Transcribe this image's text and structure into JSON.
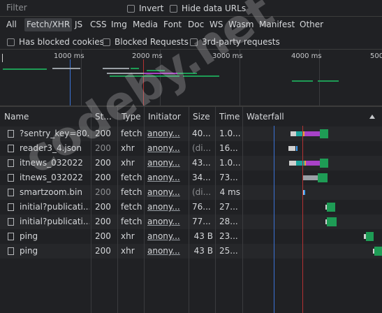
{
  "filter": {
    "placeholder": "Filter",
    "invert_label": "Invert",
    "hide_data_urls_label": "Hide data URLs"
  },
  "types": [
    "All",
    "Fetch/XHR",
    "JS",
    "CSS",
    "Img",
    "Media",
    "Font",
    "Doc",
    "WS",
    "Wasm",
    "Manifest",
    "Other"
  ],
  "active_type": "Fetch/XHR",
  "options": {
    "blocked_cookies": "Has blocked cookies",
    "blocked_requests": "Blocked Requests",
    "third_party": "3rd-party requests"
  },
  "overview": {
    "ticks": [
      "1000 ms",
      "2000 ms",
      "3000 ms",
      "4000 ms",
      "500"
    ]
  },
  "columns": {
    "name": "Name",
    "status": "St...",
    "type": "Type",
    "initiator": "Initiator",
    "size": "Size",
    "time": "Time",
    "waterfall": "Waterfall"
  },
  "rows": [
    {
      "name": "?sentry_key=80...",
      "status": "200",
      "type": "fetch",
      "initiator": "anony...",
      "size": "40...",
      "time": "1.0..."
    },
    {
      "name": "reader3_4.json",
      "status": "200",
      "type": "xhr",
      "initiator": "anony...",
      "size": "(di...",
      "time": "16..."
    },
    {
      "name": "itnews_032022",
      "status": "200",
      "type": "xhr",
      "initiator": "anony...",
      "size": "43...",
      "time": "1.0..."
    },
    {
      "name": "itnews_032022",
      "status": "200",
      "type": "fetch",
      "initiator": "anony...",
      "size": "34...",
      "time": "73..."
    },
    {
      "name": "smartzoom.bin",
      "status": "200",
      "type": "fetch",
      "initiator": "anony...",
      "size": "(di...",
      "time": "4 ms"
    },
    {
      "name": "initial?publicati...",
      "status": "200",
      "type": "fetch",
      "initiator": "anony...",
      "size": "76...",
      "time": "27..."
    },
    {
      "name": "initial?publicati...",
      "status": "200",
      "type": "fetch",
      "initiator": "anony...",
      "size": "77...",
      "time": "28..."
    },
    {
      "name": "ping",
      "status": "200",
      "type": "xhr",
      "initiator": "anony...",
      "size": "43 B",
      "time": "23..."
    },
    {
      "name": "ping",
      "status": "200",
      "type": "xhr",
      "initiator": "anony...",
      "size": "43 B",
      "time": "25..."
    }
  ],
  "watermark": "codeby.net"
}
